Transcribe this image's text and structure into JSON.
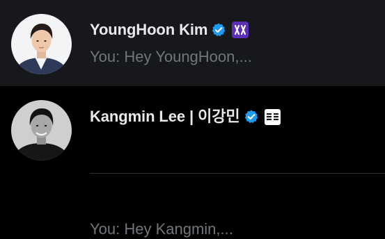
{
  "conversations": [
    {
      "name": "YoungHoon Kim",
      "verified_icon": "verified-badge-icon",
      "affiliate_icon": "purple-affiliate-logo-icon",
      "preview": "You: Hey YoungHoon,...",
      "selected": true
    },
    {
      "name": "Kangmin Lee | 이강민",
      "verified_icon": "verified-badge-icon",
      "affiliate_icon": "white-affiliate-logo-icon",
      "preview": "You: Hey Kangmin,...",
      "selected": false
    }
  ],
  "colors": {
    "background": "#000000",
    "selected_background": "#16181c",
    "name": "#e7e9ea",
    "preview": "#71767b",
    "verified_blue": "#1d9bf0",
    "affiliate_purple": "#5b2fb6",
    "divider": "#2f3336"
  }
}
